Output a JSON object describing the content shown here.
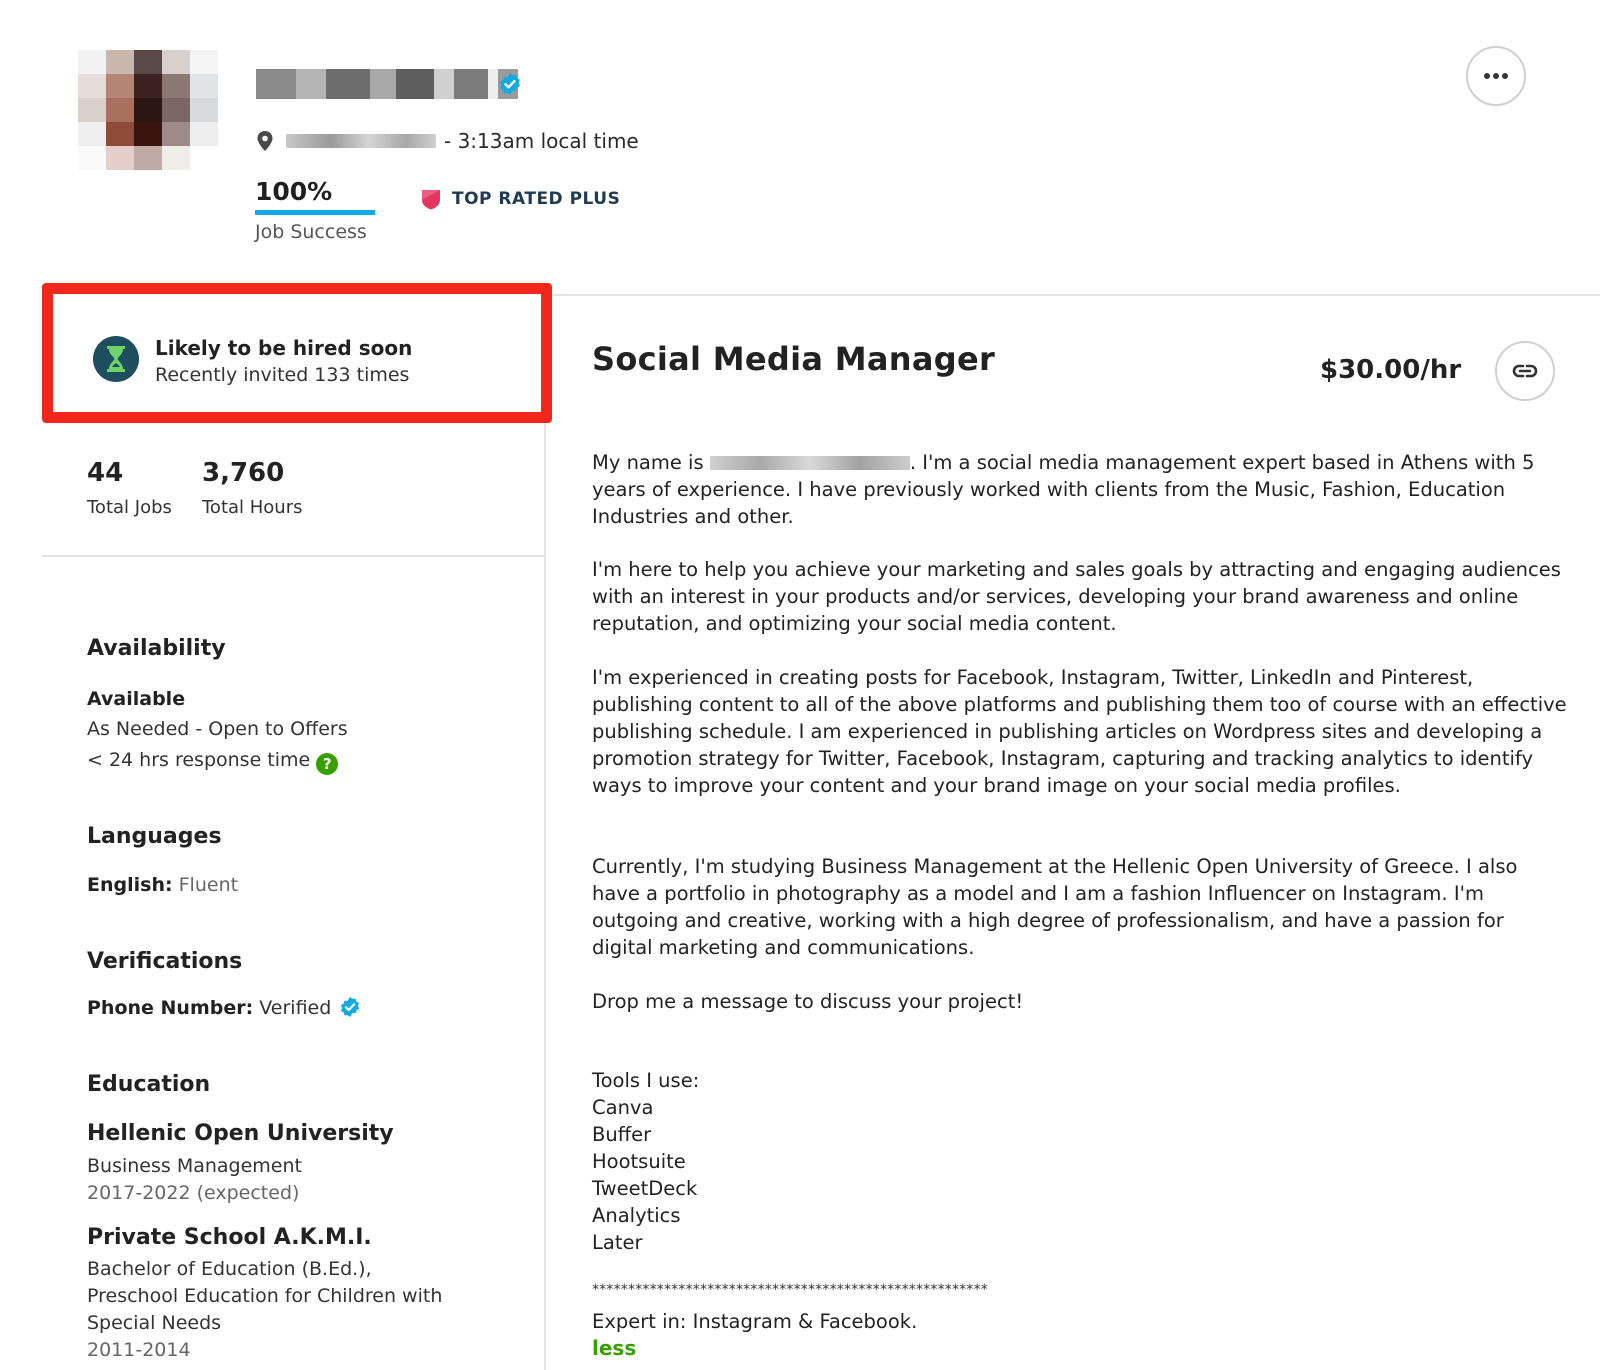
{
  "header": {
    "local_time": "- 3:13am local time",
    "job_success_pct": "100%",
    "job_success_label": "Job Success",
    "job_success_value": 1.0,
    "badge_label": "TOP RATED PLUS",
    "colors": {
      "verified_blue": "#13a9e4",
      "badge_pink": "#e2365f",
      "accent_green": "#37a000",
      "highlight_red": "#f2261b"
    }
  },
  "hire_status": {
    "title": "Likely to be hired soon",
    "subtitle": "Recently invited 133 times",
    "icon": "hourglass-icon"
  },
  "stats": [
    {
      "value": "44",
      "label": "Total Jobs"
    },
    {
      "value": "3,760",
      "label": "Total Hours"
    }
  ],
  "availability": {
    "heading": "Availability",
    "status": "Available",
    "type": "As Needed - Open to Offers",
    "response": "< 24 hrs response time",
    "help_icon_text": "?"
  },
  "languages": {
    "heading": "Languages",
    "items": [
      {
        "name": "English:",
        "level": "Fluent"
      }
    ]
  },
  "verifications": {
    "heading": "Verifications",
    "items": [
      {
        "name": "Phone Number:",
        "status": "Verified"
      }
    ]
  },
  "education": {
    "heading": "Education",
    "items": [
      {
        "school": "Hellenic Open University",
        "lines": [
          "Business Management"
        ],
        "years": "2017-2022 (expected)"
      },
      {
        "school": "Private School A.K.M.I.",
        "lines": [
          "Bachelor of Education (B.Ed.),",
          "Preschool Education for Children with",
          "Special Needs"
        ],
        "years": "2011-2014"
      }
    ]
  },
  "profile": {
    "title": "Social Media Manager",
    "rate": "$30.00/hr",
    "bio": {
      "p1_prefix": "My name is",
      "p1_rest": ". I'm a social media management expert based in Athens with 5 years of experience. I have previously worked with clients from the Music, Fashion, Education Industries and other.",
      "p2": "I'm here to help you achieve your marketing and sales goals by attracting and engaging audiences with an interest in your products and/or services, developing your brand awareness and online reputation, and optimizing your social media content.",
      "p3": "I'm experienced in creating posts for Facebook, Instagram, Twitter, LinkedIn and Pinterest, publishing content to all of the above platforms and publishing them too of course with an effective publishing schedule. I am experienced in publishing articles on Wordpress sites and developing a promotion strategy for Twitter, Facebook, Instagram, capturing and tracking analytics to identify ways to improve your content and your brand image on your social media profiles.",
      "p4": "Currently, I'm studying Business Management at the Hellenic Open University of Greece. I also have a portfolio in photography as a model and I am a fashion Influencer on Instagram. I'm outgoing and creative, working with a high degree of professionalism, and have a passion for digital marketing and communications.",
      "p5": "Drop me a message to discuss your project!"
    },
    "tools_heading": "Tools I use:",
    "tools": [
      "Canva",
      "Buffer",
      "Hootsuite",
      "TweetDeck",
      "Analytics",
      "Later"
    ],
    "divider": "*******************************************************",
    "expert": "Expert in: Instagram & Facebook.",
    "less_label": "less"
  }
}
